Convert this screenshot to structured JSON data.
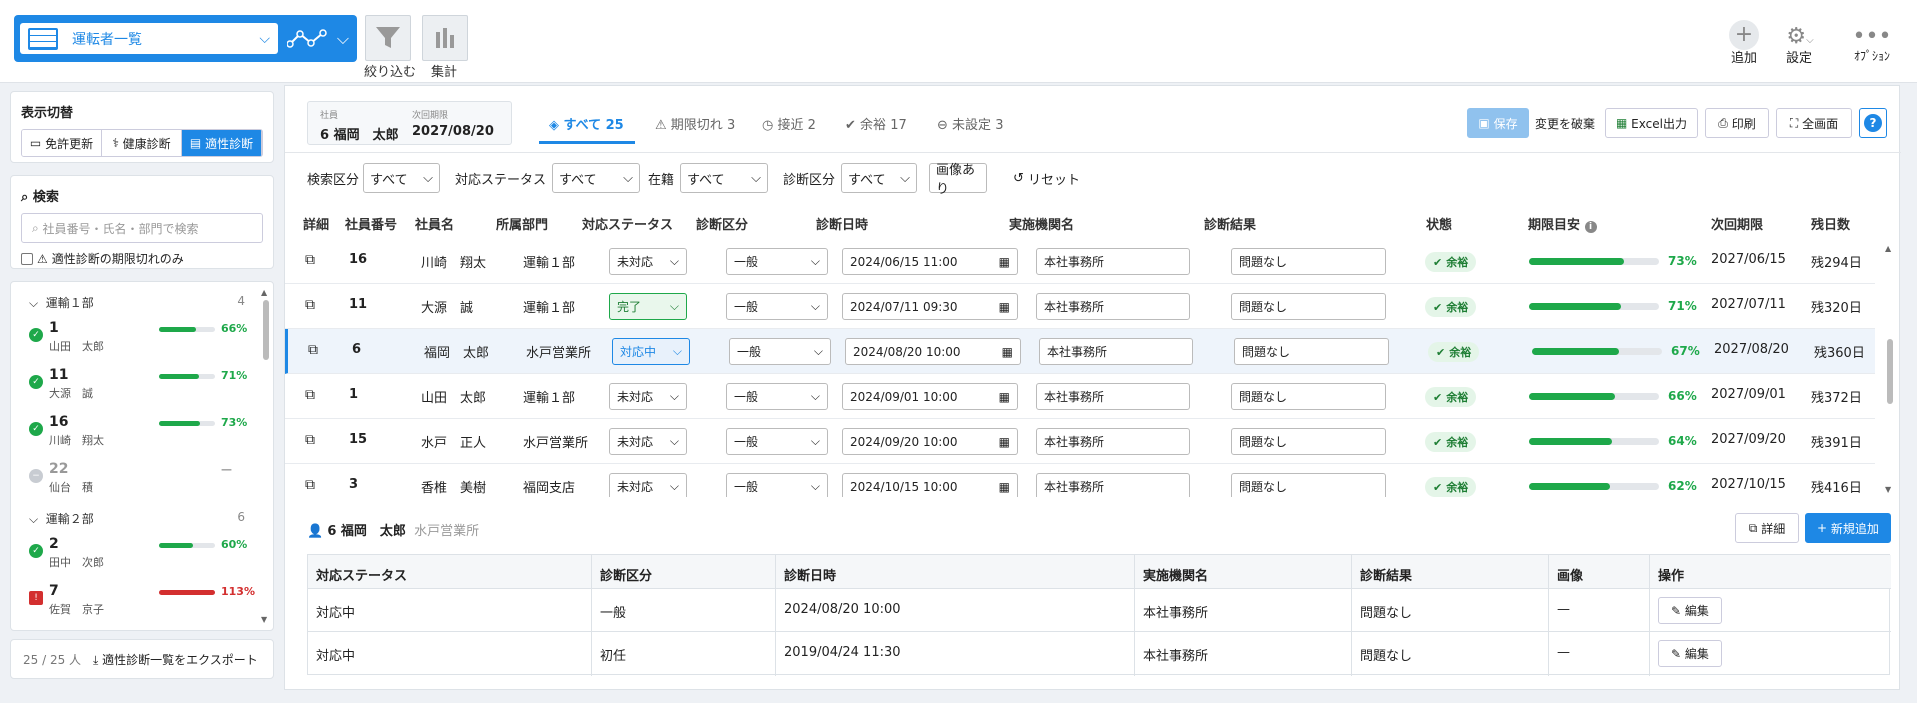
{
  "toolbar": {
    "view_name": "運転者一覧",
    "filter_label": "絞り込む",
    "aggregate_label": "集計",
    "add_label": "追加",
    "settings_label": "設定",
    "options_label": "ｵﾌﾟｼｮﾝ"
  },
  "sidebar": {
    "display_switch_title": "表示切替",
    "switch_options": [
      "免許更新",
      "健康診断",
      "適性診断"
    ],
    "active_switch": "適性診断",
    "search_title": "検索",
    "search_placeholder": "社員番号・氏名・部門で検索",
    "expired_only_label": "適性診断の期限切れのみ",
    "groups": [
      {
        "name": "運輸１部",
        "count": "4"
      },
      {
        "name": "運輸２部",
        "count": "6"
      }
    ],
    "items": [
      {
        "num": "1",
        "name": "山田　太郎",
        "pct": "66%",
        "level": 0.66,
        "status": "ok"
      },
      {
        "num": "11",
        "name": "大源　誠",
        "pct": "71%",
        "level": 0.71,
        "status": "ok"
      },
      {
        "num": "16",
        "name": "川崎　翔太",
        "pct": "73%",
        "level": 0.73,
        "status": "ok"
      },
      {
        "num": "22",
        "name": "仙台　積",
        "pct": "—",
        "level": 0,
        "status": "none"
      },
      {
        "num": "2",
        "name": "田中　次郎",
        "pct": "60%",
        "level": 0.6,
        "status": "ok"
      },
      {
        "num": "7",
        "name": "佐賀　京子",
        "pct": "113%",
        "level": 1.0,
        "status": "expired"
      }
    ],
    "footer_count": "25 / 25 人",
    "export_label": "適性診断一覧をエクスポート"
  },
  "selected": {
    "emp_label": "社員",
    "emp_value": "6 福岡　太郎",
    "next_label": "次回期限",
    "next_value": "2027/08/20"
  },
  "tabs": [
    {
      "label": "すべて",
      "count": "25"
    },
    {
      "label": "期限切れ",
      "count": "3"
    },
    {
      "label": "接近",
      "count": "2"
    },
    {
      "label": "余裕",
      "count": "17"
    },
    {
      "label": "未設定",
      "count": "3"
    }
  ],
  "actions": {
    "save": "保存",
    "discard": "変更を破棄",
    "excel": "Excel出力",
    "print": "印刷",
    "fullscreen": "全画面",
    "help": "?"
  },
  "filters": {
    "kind_label": "検索区分",
    "kind_value": "すべて",
    "status_label": "対応ステータス",
    "status_value": "すべて",
    "enroll_label": "在籍",
    "enroll_value": "すべて",
    "diag_label": "診断区分",
    "diag_value": "すべて",
    "image_label": "画像あり",
    "reset_label": "リセット"
  },
  "columns": [
    "詳細",
    "社員番号",
    "社員名",
    "所属部門",
    "対応ステータス",
    "診断区分",
    "診断日時",
    "実施機関名",
    "診断結果",
    "状態",
    "期限目安",
    "次回期限",
    "残日数"
  ],
  "rows": [
    {
      "id": "16",
      "name": "川崎　翔太",
      "dept": "運輸１部",
      "status": "未対応",
      "kind": "一般",
      "date": "2024/06/15 11:00",
      "org": "本社事務所",
      "result": "問題なし",
      "state": "余裕",
      "pct": "73%",
      "level": 0.73,
      "next": "2027/06/15",
      "remain": "残294日"
    },
    {
      "id": "11",
      "name": "大源　誠",
      "dept": "運輸１部",
      "status": "完了",
      "kind": "一般",
      "date": "2024/07/11 09:30",
      "org": "本社事務所",
      "result": "問題なし",
      "state": "余裕",
      "pct": "71%",
      "level": 0.71,
      "next": "2027/07/11",
      "remain": "残320日"
    },
    {
      "id": "6",
      "name": "福岡　太郎",
      "dept": "水戸営業所",
      "status": "対応中",
      "kind": "一般",
      "date": "2024/08/20 10:00",
      "org": "本社事務所",
      "result": "問題なし",
      "state": "余裕",
      "pct": "67%",
      "level": 0.67,
      "next": "2027/08/20",
      "remain": "残360日"
    },
    {
      "id": "1",
      "name": "山田　太郎",
      "dept": "運輸１部",
      "status": "未対応",
      "kind": "一般",
      "date": "2024/09/01 10:00",
      "org": "本社事務所",
      "result": "問題なし",
      "state": "余裕",
      "pct": "66%",
      "level": 0.66,
      "next": "2027/09/01",
      "remain": "残372日"
    },
    {
      "id": "15",
      "name": "水戸　正人",
      "dept": "水戸営業所",
      "status": "未対応",
      "kind": "一般",
      "date": "2024/09/20 10:00",
      "org": "本社事務所",
      "result": "問題なし",
      "state": "余裕",
      "pct": "64%",
      "level": 0.64,
      "next": "2027/09/20",
      "remain": "残391日"
    },
    {
      "id": "3",
      "name": "香椎　美樹",
      "dept": "福岡支店",
      "status": "未対応",
      "kind": "一般",
      "date": "2024/10/15 10:00",
      "org": "本社事務所",
      "result": "問題なし",
      "state": "余裕",
      "pct": "62%",
      "level": 0.62,
      "next": "2027/10/15",
      "remain": "残416日"
    }
  ],
  "detail": {
    "person": "6 福岡　太郎",
    "dept": "水戸営業所",
    "detail_btn": "詳細",
    "new_btn": "新規追加",
    "columns": [
      "対応ステータス",
      "診断区分",
      "診断日時",
      "実施機関名",
      "診断結果",
      "画像",
      "操作"
    ],
    "rows": [
      {
        "status": "対応中",
        "kind": "一般",
        "date": "2024/08/20 10:00",
        "org": "本社事務所",
        "result": "問題なし",
        "image": "—",
        "op": "編集"
      },
      {
        "status": "対応中",
        "kind": "初任",
        "date": "2019/04/24 11:30",
        "org": "本社事務所",
        "result": "問題なし",
        "image": "—",
        "op": "編集"
      }
    ]
  },
  "colors": {
    "accent": "#1e88e5",
    "ok": "#1ea84a",
    "danger": "#d32f2f"
  }
}
